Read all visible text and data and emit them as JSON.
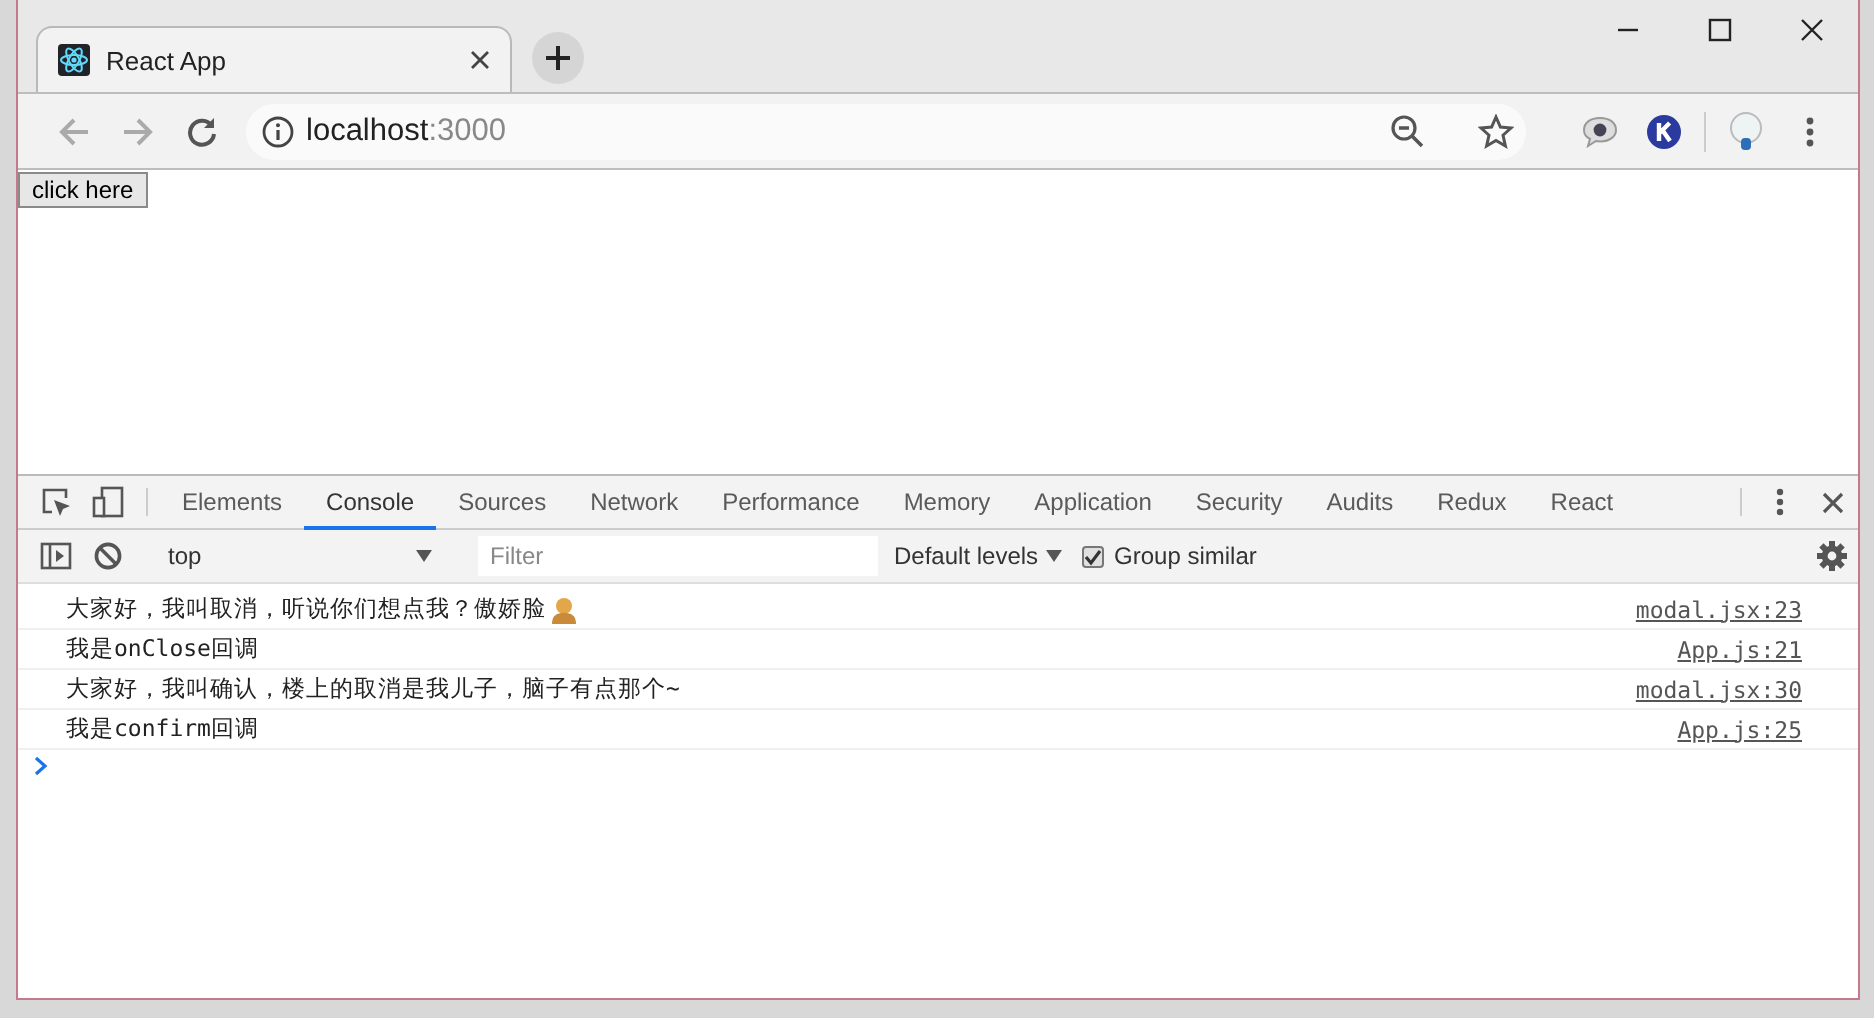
{
  "browser": {
    "tabs": [
      {
        "title": "React App",
        "selected": true
      }
    ],
    "address": {
      "host": "localhost",
      "port": ":3000"
    }
  },
  "page": {
    "buttons": [
      {
        "label": "click here"
      }
    ]
  },
  "devtools": {
    "tabs": [
      {
        "label": "Elements",
        "selected": false
      },
      {
        "label": "Console",
        "selected": true
      },
      {
        "label": "Sources",
        "selected": false
      },
      {
        "label": "Network",
        "selected": false
      },
      {
        "label": "Performance",
        "selected": false
      },
      {
        "label": "Memory",
        "selected": false
      },
      {
        "label": "Application",
        "selected": false
      },
      {
        "label": "Security",
        "selected": false
      },
      {
        "label": "Audits",
        "selected": false
      },
      {
        "label": "Redux",
        "selected": false
      },
      {
        "label": "React",
        "selected": false
      }
    ],
    "context": "top",
    "filter": {
      "placeholder": "Filter"
    },
    "levels": "Default levels",
    "group_similar": {
      "label": "Group similar",
      "checked": true
    },
    "messages": [
      {
        "text": "大家好，我叫取消，听说你们想点我？傲娇脸",
        "emoji": true,
        "source": "modal.jsx:23"
      },
      {
        "text": "我是onClose回调",
        "emoji": false,
        "source": "App.js:21"
      },
      {
        "text": "大家好，我叫确认，楼上的取消是我儿子，脑子有点那个~",
        "emoji": false,
        "source": "modal.jsx:30"
      },
      {
        "text": "我是confirm回调",
        "emoji": false,
        "source": "App.js:25"
      }
    ]
  }
}
